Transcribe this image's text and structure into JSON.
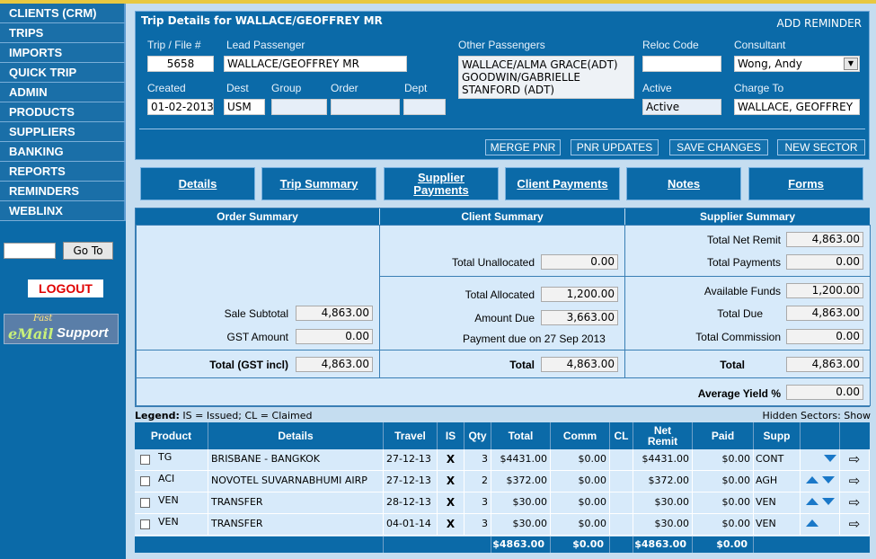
{
  "nav": [
    "CLIENTS (CRM)",
    "TRIPS",
    "IMPORTS",
    "QUICK TRIP",
    "ADMIN",
    "PRODUCTS",
    "SUPPLIERS",
    "BANKING",
    "REPORTS",
    "REMINDERS",
    "WEBLINX"
  ],
  "goto": {
    "value": "",
    "button": "Go To"
  },
  "logout": "LOGOUT",
  "support": {
    "fast": "Fast",
    "email": "eMail",
    "support": "Support"
  },
  "trip": {
    "title": "Trip Details for WALLACE/GEOFFREY MR",
    "add_reminder": "ADD REMINDER",
    "labels": {
      "file": "Trip / File #",
      "lead": "Lead Passenger",
      "other": "Other Passengers",
      "reloc": "Reloc Code",
      "consultant": "Consultant",
      "created": "Created",
      "dest": "Dest",
      "group": "Group",
      "order": "Order",
      "dept": "Dept",
      "active": "Active",
      "charge": "Charge To"
    },
    "values": {
      "file": "5658",
      "lead": "WALLACE/GEOFFREY MR",
      "other": "WALLACE/ALMA GRACE(ADT) GOODWIN/GABRIELLE STANFORD (ADT)",
      "reloc": "",
      "consultant": "Wong, Andy",
      "created": "01-02-2013",
      "dest": "USM",
      "group": "",
      "order": "",
      "dept": "",
      "active": "Active",
      "charge": "WALLACE, GEOFFREY"
    },
    "buttons": {
      "merge": "MERGE PNR",
      "pnr": "PNR UPDATES",
      "save": "SAVE CHANGES",
      "new": "NEW SECTOR"
    }
  },
  "tabs": [
    "Details",
    "Trip Summary",
    "Supplier Payments",
    "Client Payments",
    "Notes",
    "Forms"
  ],
  "summary": {
    "heads": {
      "order": "Order Summary",
      "client": "Client Summary",
      "supplier": "Supplier Summary"
    },
    "order": {
      "sale_subtotal_label": "Sale Subtotal",
      "sale_subtotal": "4,863.00",
      "gst_label": "GST Amount",
      "gst": "0.00",
      "total_label": "Total (GST incl)",
      "total": "4,863.00"
    },
    "client": {
      "unallocated_label": "Total Unallocated",
      "unallocated": "0.00",
      "allocated_label": "Total Allocated",
      "allocated": "1,200.00",
      "due_label": "Amount Due",
      "due": "3,663.00",
      "payment_note": "Payment due on 27 Sep 2013",
      "total_label": "Total",
      "total": "4,863.00"
    },
    "supplier": {
      "net_remit_label": "Total Net Remit",
      "net_remit": "4,863.00",
      "payments_label": "Total Payments",
      "payments": "0.00",
      "funds_label": "Available Funds",
      "funds": "1,200.00",
      "due_label": "Total Due",
      "due": "4,863.00",
      "commission_label": "Total Commission",
      "commission": "0.00",
      "total_label": "Total",
      "total": "4,863.00"
    },
    "yield_label": "Average Yield %",
    "yield": "0.00"
  },
  "legend": {
    "label": "Legend:",
    "text": "IS = Issued; CL = Claimed"
  },
  "hidden_sectors": "Hidden Sectors: Show",
  "table": {
    "headers": {
      "product": "Product",
      "details": "Details",
      "travel": "Travel",
      "is": "IS",
      "qty": "Qty",
      "total": "Total",
      "comm": "Comm",
      "cl": "CL",
      "net": "Net Remit",
      "paid": "Paid",
      "supp": "Supp"
    },
    "rows": [
      {
        "product": "TG",
        "details": "BRISBANE - BANGKOK",
        "travel": "27-12-13",
        "is": "X",
        "qty": "3",
        "total": "$4431.00",
        "comm": "$0.00",
        "net": "$4431.00",
        "paid": "$0.00",
        "supp": "CONT"
      },
      {
        "product": "ACI",
        "details": "NOVOTEL SUVARNABHUMI AIRP",
        "travel": "27-12-13",
        "is": "X",
        "qty": "2",
        "total": "$372.00",
        "comm": "$0.00",
        "net": "$372.00",
        "paid": "$0.00",
        "supp": "AGH"
      },
      {
        "product": "VEN",
        "details": "TRANSFER",
        "travel": "28-12-13",
        "is": "X",
        "qty": "3",
        "total": "$30.00",
        "comm": "$0.00",
        "net": "$30.00",
        "paid": "$0.00",
        "supp": "VEN"
      },
      {
        "product": "VEN",
        "details": "TRANSFER",
        "travel": "04-01-14",
        "is": "X",
        "qty": "3",
        "total": "$30.00",
        "comm": "$0.00",
        "net": "$30.00",
        "paid": "$0.00",
        "supp": "VEN"
      }
    ],
    "footer": {
      "total": "$4863.00",
      "comm": "$0.00",
      "net": "$4863.00",
      "paid": "$0.00"
    }
  }
}
